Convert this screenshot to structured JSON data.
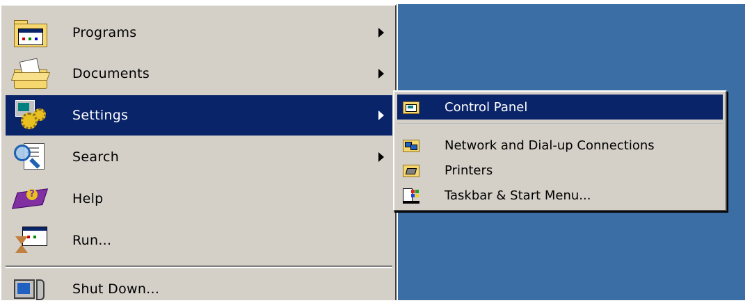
{
  "start_menu": {
    "items": [
      {
        "label": "Programs",
        "icon": "programs-folder-icon",
        "has_submenu": true
      },
      {
        "label": "Documents",
        "icon": "documents-folder-icon",
        "has_submenu": true
      },
      {
        "label": "Settings",
        "icon": "settings-gears-icon",
        "has_submenu": true,
        "selected": true
      },
      {
        "label": "Search",
        "icon": "search-magnifier-icon",
        "has_submenu": true
      },
      {
        "label": "Help",
        "icon": "help-book-icon",
        "has_submenu": false
      },
      {
        "label": "Run...",
        "icon": "run-hourglass-window-icon",
        "has_submenu": false
      },
      {
        "label": "Shut Down...",
        "icon": "shutdown-computer-icon",
        "has_submenu": false
      }
    ]
  },
  "settings_submenu": {
    "items": [
      {
        "label": "Control Panel",
        "icon": "control-panel-folder-icon",
        "selected": true
      },
      {
        "label": "Network and Dial-up Connections",
        "icon": "network-folder-icon"
      },
      {
        "label": "Printers",
        "icon": "printers-folder-icon"
      },
      {
        "label": "Taskbar & Start Menu...",
        "icon": "taskbar-start-menu-icon"
      }
    ]
  },
  "colors": {
    "menu_background": "#d4d0c8",
    "selection": "#0a246a",
    "desktop": "#3a6ea5"
  }
}
